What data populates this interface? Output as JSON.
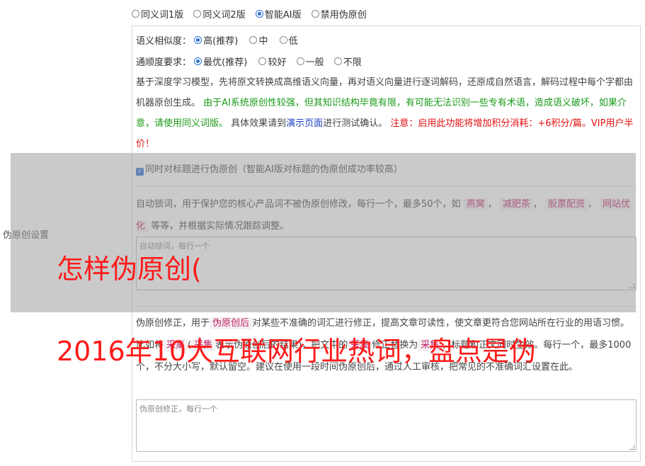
{
  "modes": {
    "options": [
      "同义词1版",
      "同义词2版",
      "智能AI版",
      "禁用伪原创"
    ],
    "selected": "智能AI版"
  },
  "similarity": {
    "label": "语义相似度：",
    "options": [
      "高(推荐)",
      "中",
      "低"
    ],
    "selected": "高(推荐)"
  },
  "fluency": {
    "label": "通顺度要求：",
    "options": [
      "最优(推荐)",
      "较好",
      "一般",
      "不限"
    ],
    "selected": "最优(推荐)"
  },
  "description": {
    "part1": "基于深度学习模型，先将原文转换成高维语义向量，再对语义向量进行逐词解码，还原成自然语言，解码过程中每个字都由机器原创生成。",
    "part2": "由于AI系统原创性较强，但其知识结构毕竟有限，有可能无法识别一些专有术语，造成语义破坏，如果介意，请使用同义词版。",
    "part3": "具体效果请到",
    "link": "演示页面",
    "part4": "进行测试确认。",
    "warning": "注意：启用此功能将增加积分消耗：+6积分/篇。VIP用户半价！"
  },
  "sidebar_label": "伪原创设置",
  "title_checkbox": {
    "label": "同时对标题进行伪原创（智能AI版对标题的伪原创成功率较高）",
    "checked": true
  },
  "lock_words": {
    "text_a": "自动锁词，用于保护您的核心产品词不被伪原创修改，每行一个，最多50个，如",
    "examples": [
      "燕窝",
      "减肥茶",
      "股票配资",
      "网站优化"
    ],
    "text_b": "等等，并根据实际情况跟踪调整。",
    "placeholder": "自动锁词，每行一个"
  },
  "correction": {
    "text_a": "伪原创修正，用于",
    "tag1": "伪原创后",
    "text_b": "对某些不准确的词汇进行修正，提高文章可读性，使文章更符合您网站所在行业的用语习惯。比如将",
    "tag2": "采集",
    "text_c": "(",
    "tag3": "采集",
    "text_d": "表示伪原创后的结果)，把文中的",
    "tag4": "采集",
    "text_e": "修正替换为",
    "tag5": "采集",
    "text_f": "，标题和正文同时生效。每行一个，最多1000个，不分大小写，默认留空。建议在使用一段时间伪原创后，通过人工审核，把常见的不准确词汇设置在此。",
    "placeholder": "伪原创修正，每行一个"
  },
  "watermark": {
    "line1": "怎样伪原创(",
    "line2": "2016年10大互联网行业热词，盘点是伪"
  }
}
